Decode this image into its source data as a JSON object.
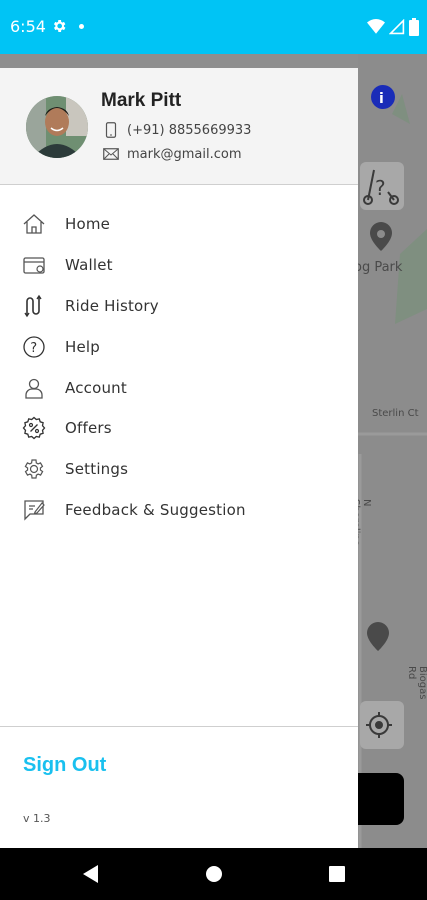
{
  "status_bar": {
    "time": "6:54"
  },
  "map": {
    "labels": {
      "park": "og Park",
      "street1": "Sterlin Ct",
      "street2": "N Shoreline Blvd",
      "street3": "Biogas Rd"
    }
  },
  "profile": {
    "name": "Mark Pitt",
    "phone": "(+91) 8855669933",
    "email": "mark@gmail.com"
  },
  "menu": {
    "items": [
      {
        "label": "Home",
        "icon": "home-icon"
      },
      {
        "label": "Wallet",
        "icon": "wallet-icon"
      },
      {
        "label": "Ride History",
        "icon": "route-icon"
      },
      {
        "label": "Help",
        "icon": "help-icon"
      },
      {
        "label": "Account",
        "icon": "user-icon"
      },
      {
        "label": "Offers",
        "icon": "offers-icon"
      },
      {
        "label": "Settings",
        "icon": "gear-icon"
      },
      {
        "label": "Feedback & Suggestion",
        "icon": "feedback-icon"
      }
    ]
  },
  "footer": {
    "sign_out": "Sign Out",
    "version": "v 1.3"
  },
  "colors": {
    "status_bar": "#00c4f5",
    "accent": "#19c0ef",
    "icon": "#555555"
  }
}
